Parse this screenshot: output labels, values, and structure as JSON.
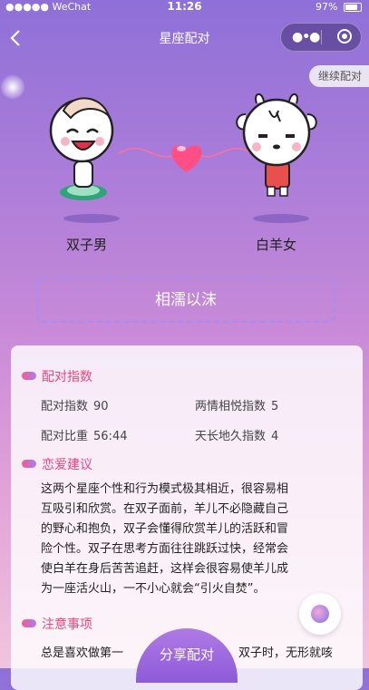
{
  "status_bar": {
    "carrier": "●●●●● WeChat",
    "time": "11:26",
    "battery": "97%"
  },
  "navbar": {
    "title": "星座配对",
    "back_icon": "chevron-left-icon",
    "menu_icon": "more-dots-icon",
    "close_icon": "target-circle-icon"
  },
  "continue_label": "继续配对",
  "pair": {
    "left_name": "双子男",
    "right_name": "白羊女",
    "verdict": "相濡以沫"
  },
  "colors": {
    "accent_pink": "#f0457a",
    "share_purple": "#9a68de",
    "dashed_border": "#a98bf5"
  },
  "match_index": {
    "title": "配对指数",
    "stats": [
      {
        "label": "配对指数",
        "value": "90"
      },
      {
        "label": "两情相悦指数",
        "value": "5"
      },
      {
        "label": "配对比重",
        "value": "56:44"
      },
      {
        "label": "天长地久指数",
        "value": "4"
      }
    ]
  },
  "love_advice": {
    "title": "恋爱建议",
    "lines": [
      "这两个星座个性和行为模式极其相近，很容易相",
      "互吸引和欣赏。在双子面前，羊儿不必隐藏自己",
      "的野心和抱负，双子会懂得欣赏羊儿的活跃和冒",
      "险个性。双子在思考方面往往跳跃过快，经常会",
      "使白羊在身后苦苦追赶，这样会很容易使羊儿成",
      "为一座活火山，一不小心就会“引火自焚”。"
    ]
  },
  "notes": {
    "title": "注意事项",
    "partial_left": "总是喜欢做第一",
    "partial_right": "双子时，无形就咳"
  },
  "share_label": "分享配对"
}
